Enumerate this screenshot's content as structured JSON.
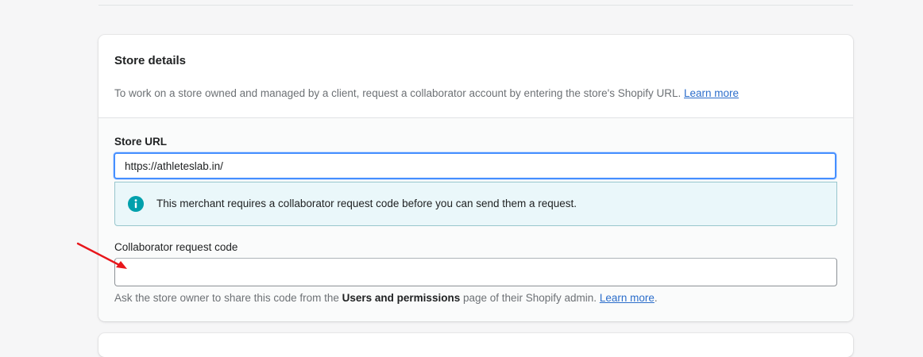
{
  "card": {
    "title": "Store details",
    "description": "To work on a store owned and managed by a client, request a collaborator account by entering the store's Shopify URL.",
    "learn_more": "Learn more"
  },
  "store_url": {
    "label": "Store URL",
    "value": "https://athleteslab.in/"
  },
  "banner": {
    "icon": "info-icon",
    "text": "This merchant requires a collaborator request code before you can send them a request.",
    "color": "#eaf7fa",
    "icon_color": "#00a0ac"
  },
  "collaborator_code": {
    "label": "Collaborator request code",
    "value": "",
    "help_prefix": "Ask the store owner to share this code from the ",
    "help_bold": "Users and permissions",
    "help_suffix": " page of their Shopify admin. ",
    "help_link": "Learn more",
    "help_end": "."
  },
  "annotation": {
    "arrow_color": "#e8161b"
  }
}
